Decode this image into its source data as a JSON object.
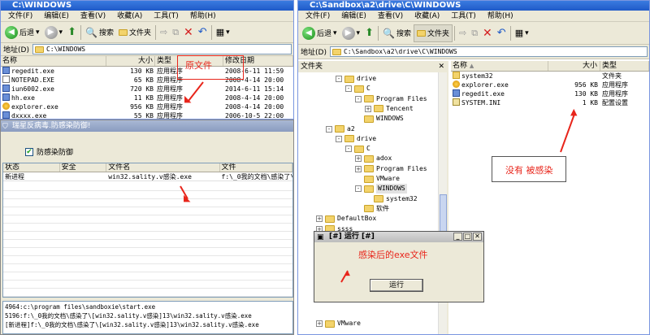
{
  "left_window": {
    "title": "C:\\WINDOWS",
    "menu": [
      "文件(F)",
      "编辑(E)",
      "查看(V)",
      "收藏(A)",
      "工具(T)",
      "帮助(H)"
    ],
    "toolbar": {
      "back": "后退",
      "search": "搜索",
      "folders": "文件夹"
    },
    "address_label": "地址(D)",
    "address_value": "C:\\WINDOWS",
    "columns": [
      "名称",
      "大小",
      "类型",
      "修改日期"
    ],
    "files": [
      {
        "name": "regedit.exe",
        "size": "130 KB",
        "type": "应用程序",
        "date": "2008-6-11 11:59",
        "icon": "app-icon"
      },
      {
        "name": "NOTEPAD.EXE",
        "size": "65 KB",
        "type": "应用程序",
        "date": "2008-4-14 20:00",
        "icon": "notepad-icon"
      },
      {
        "name": "iun6002.exe",
        "size": "720 KB",
        "type": "应用程序",
        "date": "2014-6-11 15:14",
        "icon": "app-icon"
      },
      {
        "name": "hh.exe",
        "size": "11 KB",
        "type": "应用程序",
        "date": "2008-4-14 20:00",
        "icon": "help-icon"
      },
      {
        "name": "explorer.exe",
        "size": "956 KB",
        "type": "应用程序",
        "date": "2008-4-14 20:00",
        "icon": "explorer-icon"
      },
      {
        "name": "dxxxx.exe",
        "size": "55 KB",
        "type": "应用程序",
        "date": "2006-10-5 22:00",
        "icon": "app-icon"
      }
    ],
    "annotation": "原文件"
  },
  "av_panel": {
    "title": "瑞星反病毒.防感染防御!",
    "checkbox_label": "防感染防御",
    "checkbox_checked": true,
    "columns": [
      "状态",
      "安全",
      "文件名",
      "文件"
    ],
    "row": {
      "status": "新进程",
      "safe": "",
      "filename": "win32.sality.v感染.exe",
      "path": "f:\\_0我的文档\\感染了\\"
    },
    "log": [
      "4964:c:\\program files\\sandboxie\\start.exe",
      "5196:f:\\_0我的文档\\感染了\\[win32.sality.v感染]13\\win32.sality.v感染.exe",
      "[新进程]f:\\_0我的文档\\感染了\\[win32.sality.v感染]13\\win32.sality.v感染.exe"
    ]
  },
  "right_window": {
    "title": "C:\\Sandbox\\a2\\drive\\C\\WINDOWS",
    "menu": [
      "文件(F)",
      "编辑(E)",
      "查看(V)",
      "收藏(A)",
      "工具(T)",
      "帮助(H)"
    ],
    "toolbar": {
      "back": "后退",
      "search": "搜索",
      "folders": "文件夹"
    },
    "address_label": "地址(D)",
    "address_value": "C:\\Sandbox\\a2\\drive\\C\\WINDOWS",
    "tree_header": "文件夹",
    "tree": [
      {
        "label": "drive",
        "pm": "-",
        "indent": 1
      },
      {
        "label": "C",
        "pm": "-",
        "indent": 2
      },
      {
        "label": "Program Files",
        "pm": "-",
        "indent": 3
      },
      {
        "label": "Tencent",
        "pm": "+",
        "indent": 4
      },
      {
        "label": "WINDOWS",
        "pm": "",
        "indent": 3
      },
      {
        "label": "a2",
        "pm": "-",
        "indent": 0
      },
      {
        "label": "drive",
        "pm": "-",
        "indent": 1
      },
      {
        "label": "C",
        "pm": "-",
        "indent": 2
      },
      {
        "label": "adox",
        "pm": "+",
        "indent": 3
      },
      {
        "label": "Program Files",
        "pm": "+",
        "indent": 3
      },
      {
        "label": "VMware",
        "pm": "",
        "indent": 3
      },
      {
        "label": "WINDOWS",
        "pm": "-",
        "indent": 3,
        "selected": true
      },
      {
        "label": "system32",
        "pm": "",
        "indent": 4
      },
      {
        "label": "软件",
        "pm": "",
        "indent": 3
      },
      {
        "label": "DefaultBox",
        "pm": "+",
        "indent": -1
      },
      {
        "label": "ssss",
        "pm": "+",
        "indent": -1
      }
    ],
    "tree_bottom": "VMware",
    "columns": [
      "名称",
      "大小",
      "类型"
    ],
    "files": [
      {
        "name": "system32",
        "size": "",
        "type": "文件夹",
        "icon": "folder-icon"
      },
      {
        "name": "explorer.exe",
        "size": "956 KB",
        "type": "应用程序",
        "icon": "explorer-icon"
      },
      {
        "name": "regedit.exe",
        "size": "130 KB",
        "type": "应用程序",
        "icon": "app-icon"
      },
      {
        "name": "SYSTEM.INI",
        "size": "1 KB",
        "type": "配置设置",
        "icon": "config-icon"
      }
    ],
    "annotation": "没有 被感染"
  },
  "run_dialog": {
    "title": "[#] 运行 [#]",
    "message": "感染后的exe文件",
    "button": "运行"
  }
}
